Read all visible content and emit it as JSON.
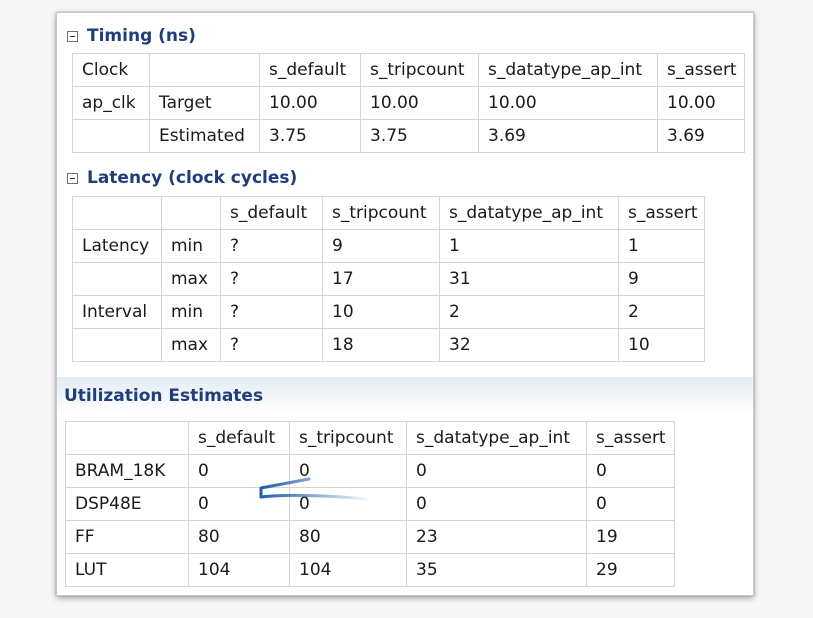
{
  "timing": {
    "title": "Timing (ns)",
    "header": [
      "Clock",
      "",
      "s_default",
      "s_tripcount",
      "s_datatype_ap_int",
      "s_assert"
    ],
    "rows": [
      [
        "ap_clk",
        "Target",
        "10.00",
        "10.00",
        "10.00",
        "10.00"
      ],
      [
        "",
        "Estimated",
        "3.75",
        "3.75",
        "3.69",
        "3.69"
      ]
    ]
  },
  "latency": {
    "title": "Latency (clock cycles)",
    "header": [
      "",
      "",
      "s_default",
      "s_tripcount",
      "s_datatype_ap_int",
      "s_assert"
    ],
    "rows": [
      [
        "Latency",
        "min",
        "?",
        "9",
        "1",
        "1"
      ],
      [
        "",
        "max",
        "?",
        "17",
        "31",
        "9"
      ],
      [
        "Interval",
        "min",
        "?",
        "10",
        "2",
        "2"
      ],
      [
        "",
        "max",
        "?",
        "18",
        "32",
        "10"
      ]
    ]
  },
  "utilization": {
    "title": "Utilization Estimates",
    "header": [
      "",
      "s_default",
      "s_tripcount",
      "s_datatype_ap_int",
      "s_assert"
    ],
    "rows": [
      [
        "BRAM_18K",
        "0",
        "0",
        "0",
        "0"
      ],
      [
        "DSP48E",
        "0",
        "0",
        "0",
        "0"
      ],
      [
        "FF",
        "80",
        "80",
        "23",
        "19"
      ],
      [
        "LUT",
        "104",
        "104",
        "35",
        "29"
      ]
    ]
  },
  "colors": {
    "section_title": "#1f3d7a",
    "grid_border": "#d4d4d4",
    "annotation_stroke": "#1e5fa8"
  }
}
